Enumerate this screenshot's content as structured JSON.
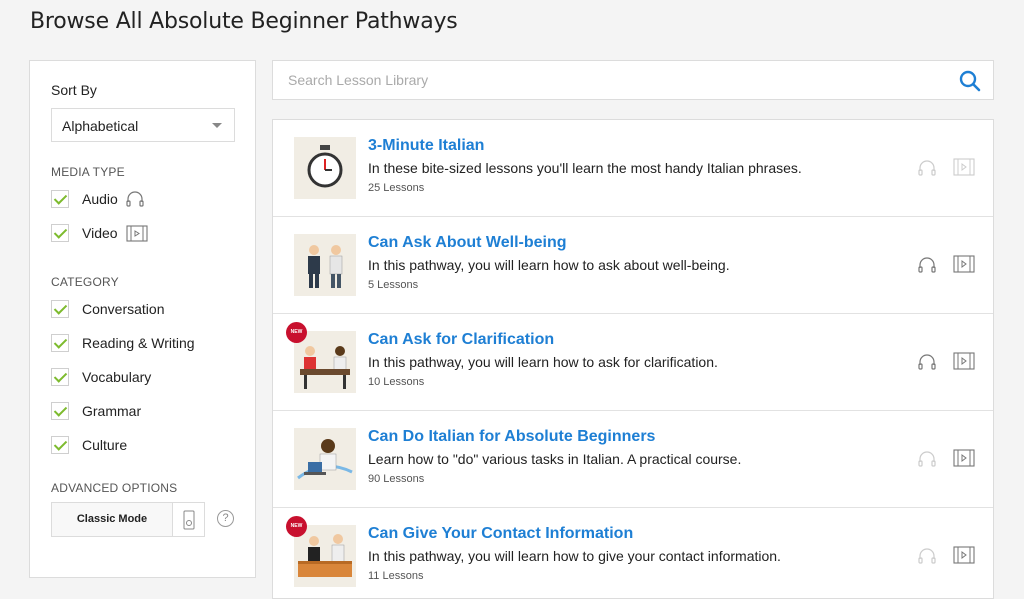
{
  "page_title": "Browse All Absolute Beginner Pathways",
  "sidebar": {
    "sort_label": "Sort By",
    "sort_value": "Alphabetical",
    "media_type_title": "MEDIA TYPE",
    "media_types": [
      {
        "label": "Audio",
        "checked": true,
        "icon": "headphones-icon"
      },
      {
        "label": "Video",
        "checked": true,
        "icon": "video-icon"
      }
    ],
    "category_title": "CATEGORY",
    "categories": [
      {
        "label": "Conversation",
        "checked": true
      },
      {
        "label": "Reading & Writing",
        "checked": true
      },
      {
        "label": "Vocabulary",
        "checked": true
      },
      {
        "label": "Grammar",
        "checked": true
      },
      {
        "label": "Culture",
        "checked": true
      }
    ],
    "advanced_title": "ADVANCED OPTIONS",
    "classic_mode_label": "Classic Mode",
    "help_label": "?"
  },
  "search": {
    "placeholder": "Search Lesson Library",
    "value": ""
  },
  "results": [
    {
      "title": "3-Minute Italian",
      "description": "In these bite-sized lessons you'll learn the most handy Italian phrases.",
      "count": "25 Lessons",
      "new": false,
      "audio": "faded",
      "video": "faded",
      "thumb": "stopwatch"
    },
    {
      "title": "Can Ask About Well-being",
      "description": "In this pathway, you will learn how to ask about well-being.",
      "count": "5 Lessons",
      "new": false,
      "audio": "active",
      "video": "active",
      "thumb": "two-people"
    },
    {
      "title": "Can Ask for Clarification",
      "description": "In this pathway, you will learn how to ask for clarification.",
      "count": "10 Lessons",
      "new": true,
      "new_label": "NEW",
      "audio": "active",
      "video": "active",
      "thumb": "meeting"
    },
    {
      "title": "Can Do Italian for Absolute Beginners",
      "description": "Learn how to \"do\" various tasks in Italian. A practical course.",
      "count": "90 Lessons",
      "new": false,
      "audio": "faded",
      "video": "active",
      "thumb": "laptop"
    },
    {
      "title": "Can Give Your Contact Information",
      "description": "In this pathway, you will learn how to give your contact information.",
      "count": "11 Lessons",
      "new": true,
      "new_label": "NEW",
      "audio": "faded",
      "video": "active",
      "thumb": "desk"
    }
  ],
  "colors": {
    "link": "#1e7fd4",
    "check": "#7dbb2e",
    "new_badge": "#c8102e"
  }
}
